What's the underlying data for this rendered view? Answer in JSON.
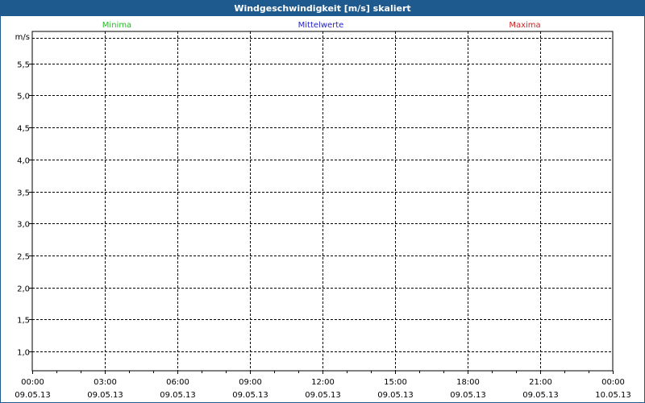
{
  "title": "Windgeschwindigkeit [m/s] skaliert",
  "chart_data": {
    "type": "line",
    "title": "Windgeschwindigkeit [m/s] skaliert",
    "ylabel": "m/s",
    "ylim": [
      0.7,
      6.0
    ],
    "ytick_values": [
      1.0,
      1.5,
      2.0,
      2.5,
      3.0,
      3.5,
      4.0,
      4.5,
      5.0,
      5.5
    ],
    "ytick_labels": [
      "1,0",
      "1,5",
      "2,0",
      "2,5",
      "3,0",
      "3,5",
      "4,0",
      "4,5",
      "5,0",
      "5,5"
    ],
    "xlim": [
      "2013-05-09 00:00",
      "2013-05-10 00:00"
    ],
    "xticks": [
      {
        "time": "00:00",
        "date": "09.05.13"
      },
      {
        "time": "03:00",
        "date": "09.05.13"
      },
      {
        "time": "06:00",
        "date": "09.05.13"
      },
      {
        "time": "09:00",
        "date": "09.05.13"
      },
      {
        "time": "12:00",
        "date": "09.05.13"
      },
      {
        "time": "15:00",
        "date": "09.05.13"
      },
      {
        "time": "18:00",
        "date": "09.05.13"
      },
      {
        "time": "21:00",
        "date": "09.05.13"
      },
      {
        "time": "00:00",
        "date": "10.05.13"
      }
    ],
    "grid": true,
    "legend_position": "top",
    "series": [
      {
        "name": "Minima",
        "color": "#22bb22",
        "values": []
      },
      {
        "name": "Mittelwerte",
        "color": "#2222cc",
        "values": []
      },
      {
        "name": "Maxima",
        "color": "#cc2222",
        "values": []
      }
    ]
  }
}
